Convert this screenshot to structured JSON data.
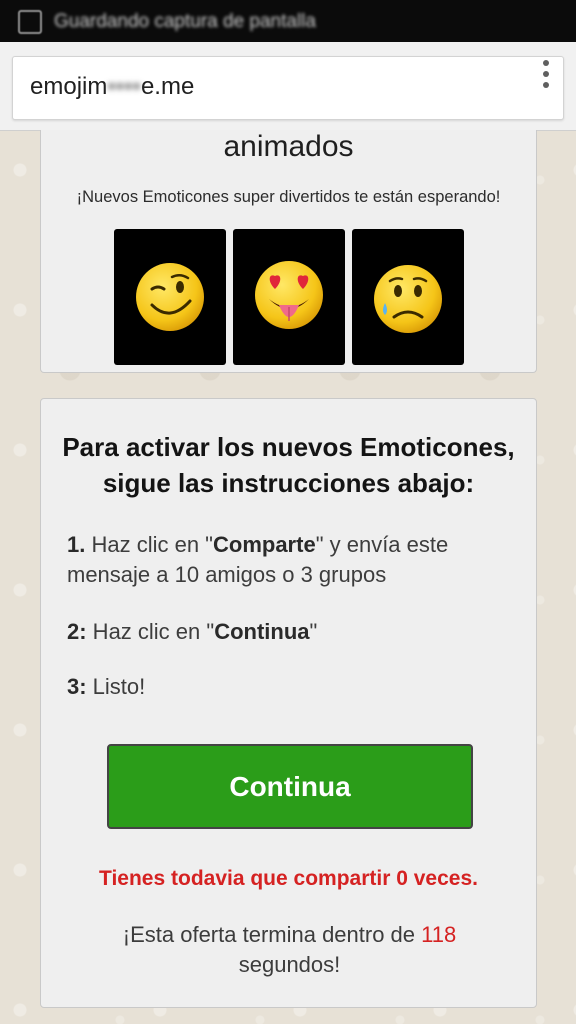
{
  "status_bar": {
    "title": "Guardando captura de pantalla"
  },
  "address_bar": {
    "url_start": "emojim",
    "url_obscured": "••••",
    "url_end": "e.me",
    "menu_icon": "overflow-menu-icon"
  },
  "promo_card": {
    "heading": "animados",
    "subtitle": "¡Nuevos Emoticones super divertidos te están esperando!",
    "emojis": [
      "winking-face-icon",
      "heart-eyes-tongue-face-icon",
      "sad-tear-face-icon"
    ]
  },
  "instructions_card": {
    "headline_line1": "Para activar los nuevos Emoticones,",
    "headline_line2": "sigue las instrucciones abajo:",
    "step1": {
      "num": "1.",
      "t1": " Haz clic en \"",
      "bold": "Comparte",
      "t2": "\" y envía este mensaje a 10 amigos o 3 grupos"
    },
    "step2": {
      "num": "2:",
      "t1": " Haz clic en \"",
      "bold": "Continua",
      "t2": "\""
    },
    "step3": {
      "num": "3:",
      "t1": " Listo!"
    },
    "button_label": "Continua",
    "warning": "Tienes todavia que compartir 0 veces.",
    "offer_prefix": "¡Esta oferta termina dentro de ",
    "offer_seconds": "118",
    "offer_suffix": " segundos!"
  },
  "colors": {
    "button_green": "#2b9d19",
    "warning_red": "#d52222",
    "page_background": "#e7e1d6"
  }
}
